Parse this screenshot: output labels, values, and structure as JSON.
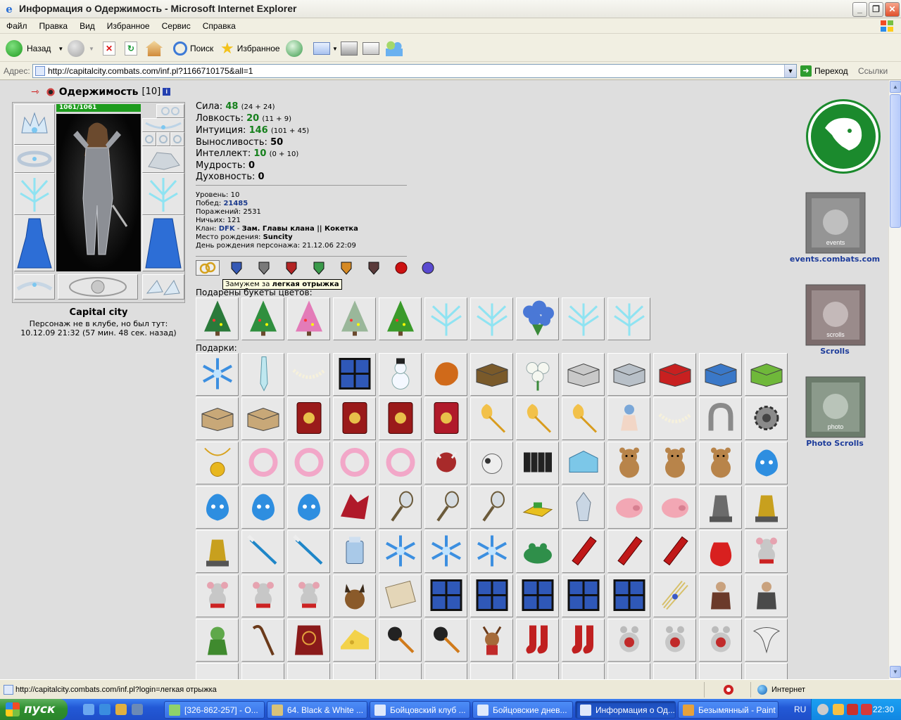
{
  "window": {
    "title": "Информация о Одержимость - Microsoft Internet Explorer",
    "buttons": {
      "minimize": "_",
      "maximize": "❐",
      "close": "✕"
    }
  },
  "menu": [
    "Файл",
    "Правка",
    "Вид",
    "Избранное",
    "Сервис",
    "Справка"
  ],
  "toolbar": {
    "back": "Назад",
    "search": "Поиск",
    "favorites": "Избранное"
  },
  "address": {
    "label": "Адрес:",
    "url": "http://capitalcity.combats.com/inf.pl?1166710175&all=1",
    "go": "Переход",
    "links": "Ссылки"
  },
  "character": {
    "name": "Одержимость",
    "level": "[10]",
    "hp": "1061/1061",
    "city": "Capital city",
    "last_seen_line1": "Персонаж не в клубе, но был тут:",
    "last_seen_line2": "10.12.09 21:32 (57 мин. 48 сек. назад)"
  },
  "stats": [
    {
      "label": "Сила:",
      "value": "48",
      "bonus": "(24 + 24)",
      "green": true
    },
    {
      "label": "Ловкость:",
      "value": "20",
      "bonus": "(11 + 9)",
      "green": true
    },
    {
      "label": "Интуиция:",
      "value": "146",
      "bonus": "(101 + 45)",
      "green": true
    },
    {
      "label": "Выносливость:",
      "value": "50",
      "bonus": "",
      "green": false
    },
    {
      "label": "Интеллект:",
      "value": "10",
      "bonus": "(0 + 10)",
      "green": true
    },
    {
      "label": "Мудрость:",
      "value": "0",
      "bonus": "",
      "green": false
    },
    {
      "label": "Духовность:",
      "value": "0",
      "bonus": "",
      "green": false
    }
  ],
  "info": {
    "level_label": "Уровень:",
    "level": "10",
    "wins_label": "Побед:",
    "wins": "21485",
    "losses_label": "Поражений:",
    "losses": "2531",
    "draws_label": "Ничьих:",
    "draws": "121",
    "clan_label": "Клан:",
    "clan": "DFK",
    "clan_sep": "-",
    "clan_role": "Зам. Главы клана || Кокетка",
    "birthplace_label": "Место рождения:",
    "birthplace": "Suncity",
    "birthday_label": "День рождения персонажа:",
    "birthday": "21.12.06 22:09"
  },
  "tooltip": {
    "prefix": "Замужем за",
    "name": "легкая отрыжка"
  },
  "sections": {
    "flowers": "Подарены букеты цветов:",
    "gifts": "Подарки:"
  },
  "right": {
    "events_label": "events.combats.com",
    "events_banner": "events",
    "scrolls_label": "Scrolls",
    "scrolls_banner": "scrolls",
    "photo_label": "Photo Scrolls",
    "photo_banner": "photo"
  },
  "status": {
    "url": "http://capitalcity.combats.com/inf.pl?login=легкая отрыжка",
    "zone": "Интернет"
  },
  "taskbar": {
    "start": "пуск",
    "tasks": [
      "[326-862-257] - O...",
      "64. Black & White ...",
      "Бойцовский клуб ...",
      "Бойцовские днев...",
      "Информация о Од...",
      "Безымянный - Paint"
    ],
    "lang": "RU",
    "clock": "22:30"
  },
  "colors": {
    "accent_green": "#15801c",
    "link_blue": "#1c3b9a",
    "clan_logo": "#1b8a2d"
  }
}
